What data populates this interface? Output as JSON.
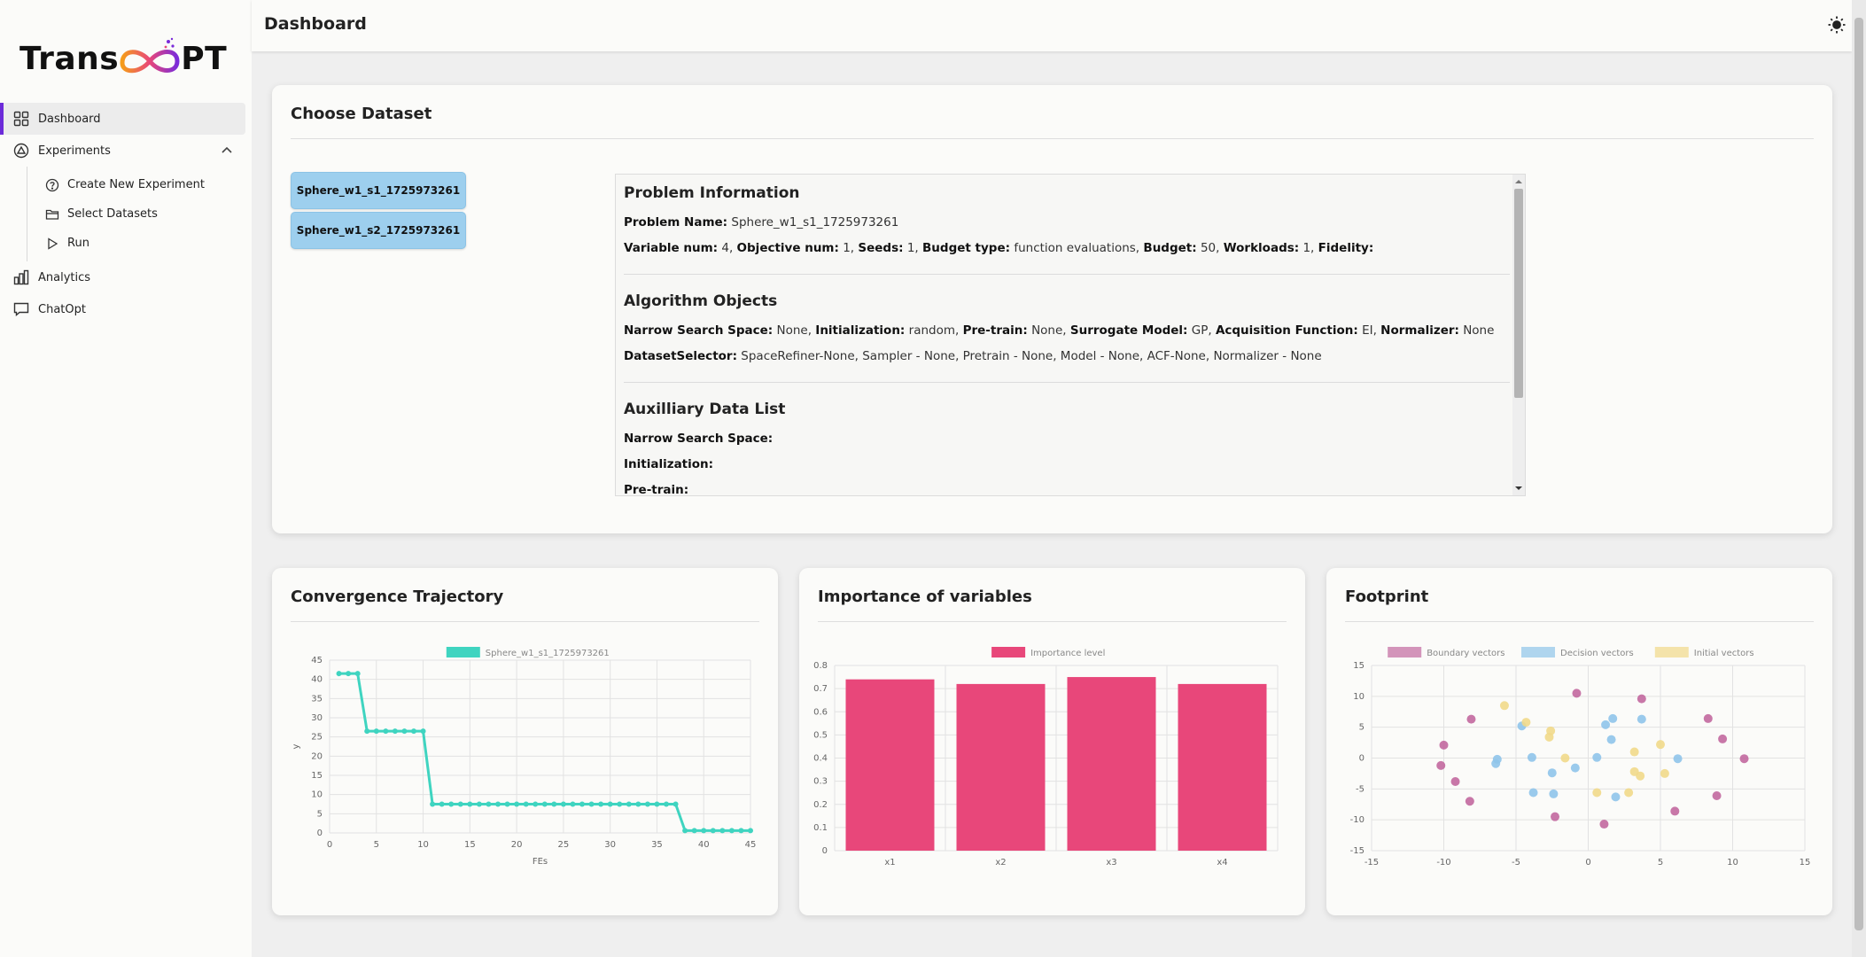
{
  "app": {
    "logo_text_left": "Trans",
    "logo_text_right": "PT",
    "page_title": "Dashboard"
  },
  "sidebar": {
    "items": [
      {
        "label": "Dashboard",
        "icon": "grid-icon",
        "active": true
      },
      {
        "label": "Experiments",
        "icon": "experiment-icon"
      },
      {
        "label": "Analytics",
        "icon": "bar-chart-icon"
      },
      {
        "label": "ChatOpt",
        "icon": "chat-icon"
      }
    ],
    "sub_items": [
      {
        "label": "Create New Experiment",
        "icon": "help-circle-icon"
      },
      {
        "label": "Select Datasets",
        "icon": "folder-icon"
      },
      {
        "label": "Run",
        "icon": "play-icon"
      }
    ]
  },
  "choose_dataset": {
    "title": "Choose Dataset",
    "datasets": [
      "Sphere_w1_s1_1725973261",
      "Sphere_w1_s2_1725973261"
    ],
    "problem_info": {
      "heading": "Problem Information",
      "name_label": "Problem Name:",
      "name_value": "Sphere_w1_s1_1725973261",
      "var_label": "Variable num:",
      "var_value": "4,",
      "obj_label": "Objective num:",
      "obj_value": "1,",
      "seeds_label": "Seeds:",
      "seeds_value": "1,",
      "budget_type_label": "Budget type:",
      "budget_type_value": "function evaluations,",
      "budget_label": "Budget:",
      "budget_value": "50,",
      "workloads_label": "Workloads:",
      "workloads_value": "1,",
      "fidelity_label": "Fidelity:"
    },
    "algorithm_objects": {
      "heading": "Algorithm Objects",
      "nss_label": "Narrow Search Space:",
      "nss_value": "None,",
      "init_label": "Initialization:",
      "init_value": "random,",
      "pretrain_label": "Pre-train:",
      "pretrain_value": "None,",
      "surrogate_label": "Surrogate Model:",
      "surrogate_value": "GP,",
      "acq_label": "Acquisition Function:",
      "acq_value": "EI,",
      "norm_label": "Normalizer:",
      "norm_value": "None",
      "dsel_label": "DatasetSelector:",
      "dsel_value": "SpaceRefiner-None, Sampler - None, Pretrain - None, Model - None, ACF-None, Normalizer - None"
    },
    "auxiliary": {
      "heading": "Auxilliary Data List",
      "nss_label": "Narrow Search Space:",
      "init_label": "Initialization:",
      "pretrain_label": "Pre-train:"
    }
  },
  "chart_data": [
    {
      "type": "line",
      "title": "Convergence Trajectory",
      "xlabel": "FEs",
      "ylabel": "y",
      "xlim": [
        0,
        45
      ],
      "ylim": [
        0,
        45
      ],
      "xticks": [
        0,
        5,
        10,
        15,
        20,
        25,
        30,
        35,
        40,
        45
      ],
      "yticks": [
        0,
        5,
        10,
        15,
        20,
        25,
        30,
        35,
        40,
        45
      ],
      "legend_placement": "top",
      "color": "#3fd4c0",
      "series": [
        {
          "name": "Sphere_w1_s1_1725973261",
          "x": [
            1,
            2,
            3,
            4,
            5,
            6,
            7,
            8,
            9,
            10,
            11,
            12,
            13,
            14,
            15,
            16,
            17,
            18,
            19,
            20,
            21,
            22,
            23,
            24,
            25,
            26,
            27,
            28,
            29,
            30,
            31,
            32,
            33,
            34,
            35,
            36,
            37,
            38,
            39,
            40,
            41,
            42,
            43,
            44,
            45
          ],
          "values": [
            41.5,
            41.5,
            41.5,
            26.5,
            26.5,
            26.5,
            26.5,
            26.5,
            26.5,
            26.5,
            7.5,
            7.5,
            7.5,
            7.5,
            7.5,
            7.5,
            7.5,
            7.5,
            7.5,
            7.5,
            7.5,
            7.5,
            7.5,
            7.5,
            7.5,
            7.5,
            7.5,
            7.5,
            7.5,
            7.5,
            7.5,
            7.5,
            7.5,
            7.5,
            7.5,
            7.5,
            7.5,
            0.6,
            0.6,
            0.6,
            0.6,
            0.6,
            0.6,
            0.6,
            0.6
          ]
        }
      ]
    },
    {
      "type": "bar",
      "title": "Importance of variables",
      "categories": [
        "x1",
        "x2",
        "x3",
        "x4"
      ],
      "ylim": [
        0,
        0.8
      ],
      "yticks": [
        0,
        0.1,
        0.2,
        0.3,
        0.4,
        0.5,
        0.6,
        0.7,
        0.8
      ],
      "legend_placement": "top",
      "color": "#e8477a",
      "series": [
        {
          "name": "Importance level",
          "values": [
            0.74,
            0.72,
            0.75,
            0.72
          ]
        }
      ]
    },
    {
      "type": "scatter",
      "title": "Footprint",
      "xlim": [
        -15,
        15
      ],
      "ylim": [
        -15,
        15
      ],
      "xticks": [
        -15,
        -10,
        -5,
        0,
        5,
        10,
        15
      ],
      "yticks": [
        -15,
        -10,
        -5,
        0,
        5,
        10,
        15
      ],
      "legend_placement": "top",
      "series": [
        {
          "name": "Boundary vectors",
          "color": "#c2689f",
          "points": [
            [
              -0.8,
              10.5
            ],
            [
              3.7,
              9.6
            ],
            [
              -8.1,
              6.3
            ],
            [
              8.3,
              6.4
            ],
            [
              -10.0,
              2.1
            ],
            [
              9.3,
              3.1
            ],
            [
              10.8,
              -0.1
            ],
            [
              -10.2,
              -1.2
            ],
            [
              -9.2,
              -3.8
            ],
            [
              8.9,
              -6.1
            ],
            [
              -8.2,
              -7.0
            ],
            [
              6.0,
              -8.6
            ],
            [
              -2.3,
              -9.5
            ],
            [
              1.1,
              -10.7
            ]
          ]
        },
        {
          "name": "Decision vectors",
          "color": "#8fc4ea",
          "points": [
            [
              -4.6,
              5.2
            ],
            [
              1.7,
              6.4
            ],
            [
              3.7,
              6.3
            ],
            [
              1.2,
              5.4
            ],
            [
              1.6,
              3.0
            ],
            [
              -6.3,
              -0.2
            ],
            [
              -3.9,
              0.1
            ],
            [
              -6.4,
              -0.9
            ],
            [
              -2.5,
              -2.4
            ],
            [
              -0.9,
              -1.6
            ],
            [
              0.6,
              0.1
            ],
            [
              6.2,
              -0.1
            ],
            [
              -3.8,
              -5.6
            ],
            [
              -2.4,
              -5.8
            ],
            [
              1.9,
              -6.3
            ]
          ]
        },
        {
          "name": "Initial vectors",
          "color": "#f1d989",
          "points": [
            [
              -5.8,
              8.5
            ],
            [
              -4.3,
              5.8
            ],
            [
              -2.6,
              4.4
            ],
            [
              -2.7,
              3.4
            ],
            [
              5.0,
              2.2
            ],
            [
              3.2,
              1.0
            ],
            [
              -1.6,
              0.0
            ],
            [
              3.2,
              -2.2
            ],
            [
              3.6,
              -2.9
            ],
            [
              5.3,
              -2.5
            ],
            [
              0.6,
              -5.6
            ],
            [
              2.8,
              -5.6
            ]
          ]
        }
      ]
    }
  ]
}
